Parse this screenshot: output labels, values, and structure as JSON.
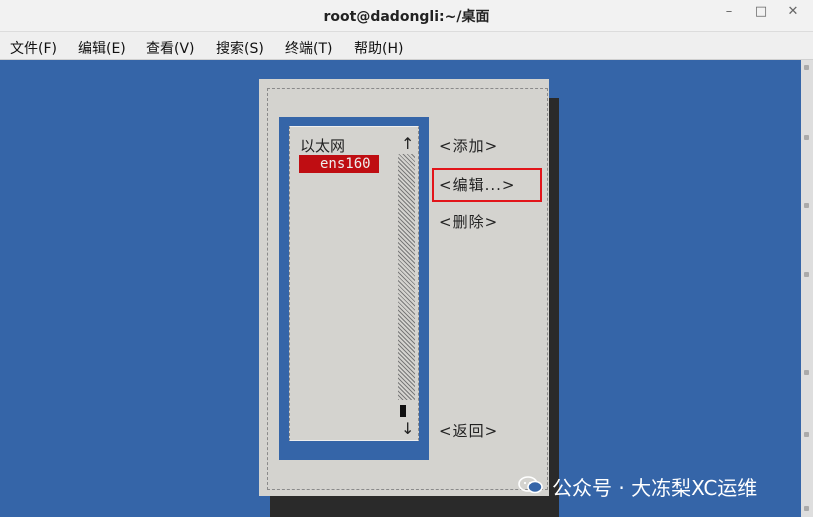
{
  "window": {
    "title": "root@dadongli:~/桌面",
    "minimize_label": "–",
    "maximize_label": "□",
    "close_label": "✕"
  },
  "menu": [
    {
      "label": "文件(F)"
    },
    {
      "label": "编辑(E)"
    },
    {
      "label": "查看(V)"
    },
    {
      "label": "搜索(S)"
    },
    {
      "label": "终端(T)"
    },
    {
      "label": "帮助(H)"
    }
  ],
  "dialog": {
    "list_header": "以太网",
    "connections": [
      {
        "name": "ens160",
        "selected": true
      }
    ],
    "scroll_up_glyph": "↑",
    "scroll_down_glyph": "↓",
    "buttons": {
      "add": "<添加>",
      "edit": "<编辑...>",
      "delete": "<删除>",
      "back": "<返回>"
    }
  },
  "watermark": {
    "text": "公众号 · 大冻梨XC运维",
    "icon": "wechat-icon"
  },
  "colors": {
    "terminal_bg": "#3565a8",
    "dialog_bg": "#d4d3cf",
    "selection_bg": "#bf0d12",
    "annotation_red": "#e2141a"
  }
}
